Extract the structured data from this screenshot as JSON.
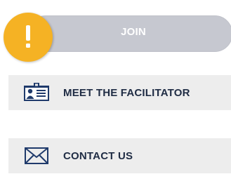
{
  "join": {
    "label": "JOIN",
    "alert_icon": "exclamation-icon",
    "pill_color": "#c6c8d0",
    "alert_color": "#f5b224"
  },
  "items": [
    {
      "label": "MEET THE FACILITATOR",
      "icon": "id-card-icon"
    },
    {
      "label": "CONTACT US",
      "icon": "envelope-icon"
    }
  ],
  "colors": {
    "item_bg": "#ededed",
    "item_text": "#1f2c44",
    "icon_color": "#1f3a6b"
  }
}
